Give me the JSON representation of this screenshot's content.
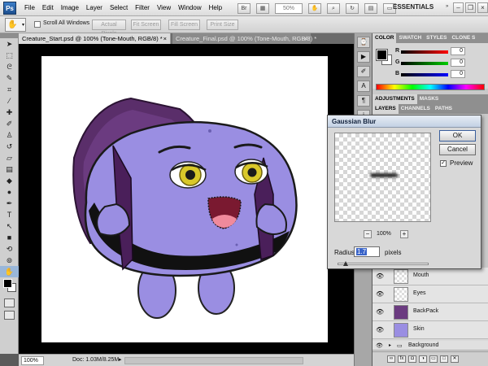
{
  "app": {
    "logo": "Ps",
    "menus": [
      "File",
      "Edit",
      "Image",
      "Layer",
      "Select",
      "Filter",
      "View",
      "Window",
      "Help"
    ],
    "zoom": "50%",
    "workspace": "ESSENTIALS"
  },
  "options": {
    "scroll_all_windows": "Scroll All Windows",
    "actual_pixels": "Actual Pixels",
    "fit_screen": "Fit Screen",
    "fill_screen": "Fill Screen",
    "print_size": "Print Size"
  },
  "tabs": {
    "active": "Creature_Start.psd @ 100% (Tone-Mouth, RGB/8) *",
    "inactive": "Creature_Final.psd @ 100% (Tone-Mouth, RGB/8) *",
    "close": "×"
  },
  "status": {
    "zoom": "100%",
    "doc": "Doc: 1.03M/8.25M"
  },
  "panels": {
    "color_tabs": [
      "COLOR",
      "SWATCH",
      "STYLES",
      "CLONE S"
    ],
    "adjust_tabs": [
      "ADJUSTMENTS",
      "MASKS"
    ],
    "layer_tabs": [
      "LAYERS",
      "CHANNELS",
      "PATHS"
    ],
    "rgb": [
      {
        "label": "R",
        "value": "0"
      },
      {
        "label": "G",
        "value": "0"
      },
      {
        "label": "B",
        "value": "0"
      }
    ],
    "layers": [
      "Mouth",
      "Eyes",
      "BackPack",
      "Skin"
    ],
    "group": "Background"
  },
  "dialog": {
    "title": "Gaussian Blur",
    "ok": "OK",
    "cancel": "Cancel",
    "preview": "Preview",
    "zoom": "100%",
    "radius_label": "Radius:",
    "radius_value": "1.7",
    "radius_unit": "pixels"
  },
  "colors": {
    "creature_body": "#9a8ee2",
    "backpack": "#5a2e6a",
    "eye": "#d9c82a",
    "mouth": "#f08a9c"
  }
}
